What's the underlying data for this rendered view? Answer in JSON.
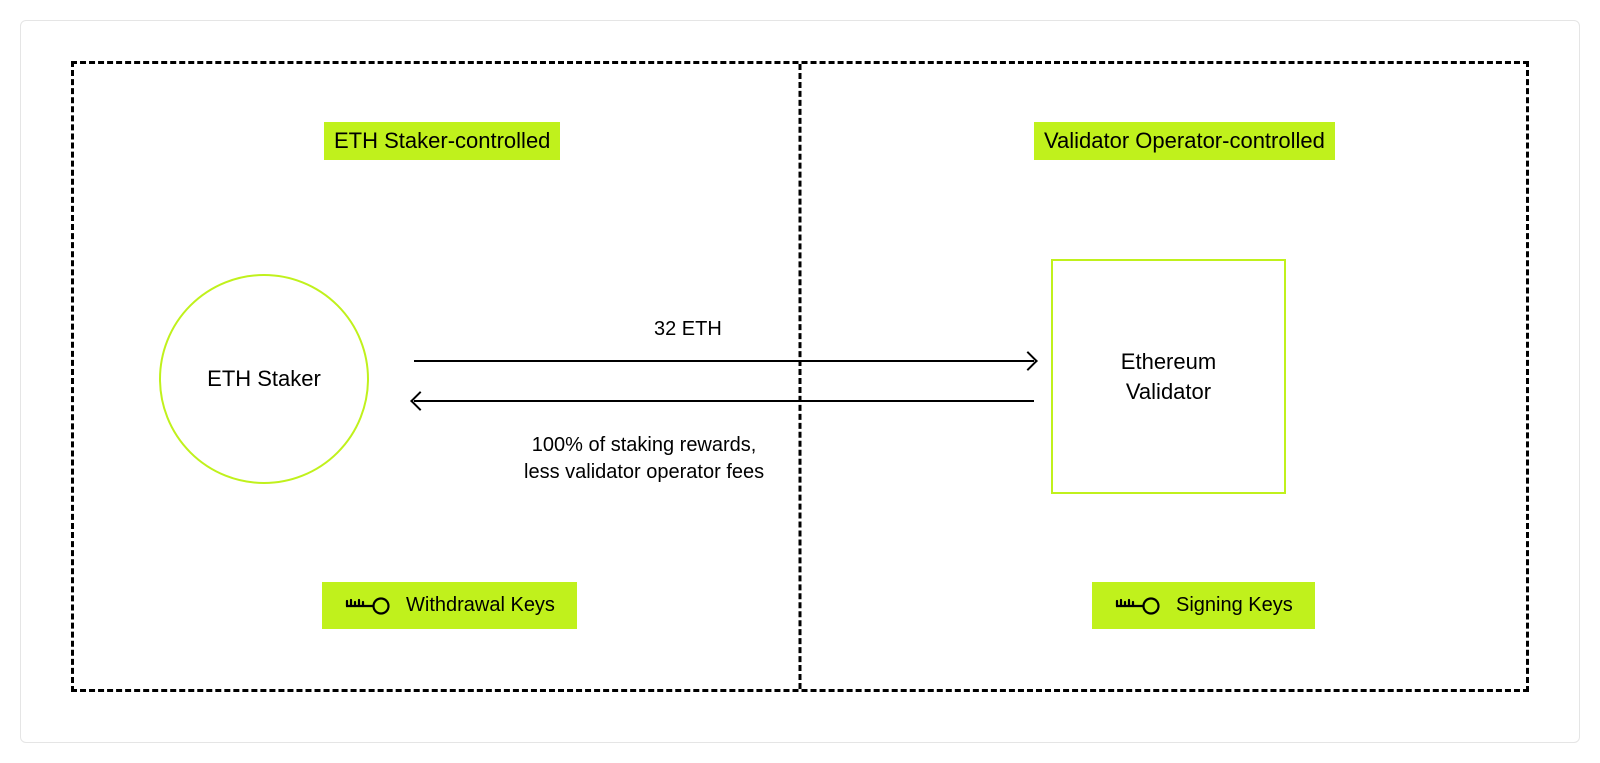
{
  "diagram": {
    "left_section": {
      "header": "ETH Staker-controlled"
    },
    "right_section": {
      "header": "Validator Operator-controlled"
    },
    "nodes": {
      "staker": "ETH Staker",
      "validator": "Ethereum\nValidator"
    },
    "flows": {
      "to_validator": "32 ETH",
      "to_staker": "100% of staking rewards,\nless validator operator fees"
    },
    "keys": {
      "withdrawal": "Withdrawal Keys",
      "signing": "Signing Keys"
    },
    "colors": {
      "accent": "#c0f11c",
      "line": "#000000"
    }
  }
}
